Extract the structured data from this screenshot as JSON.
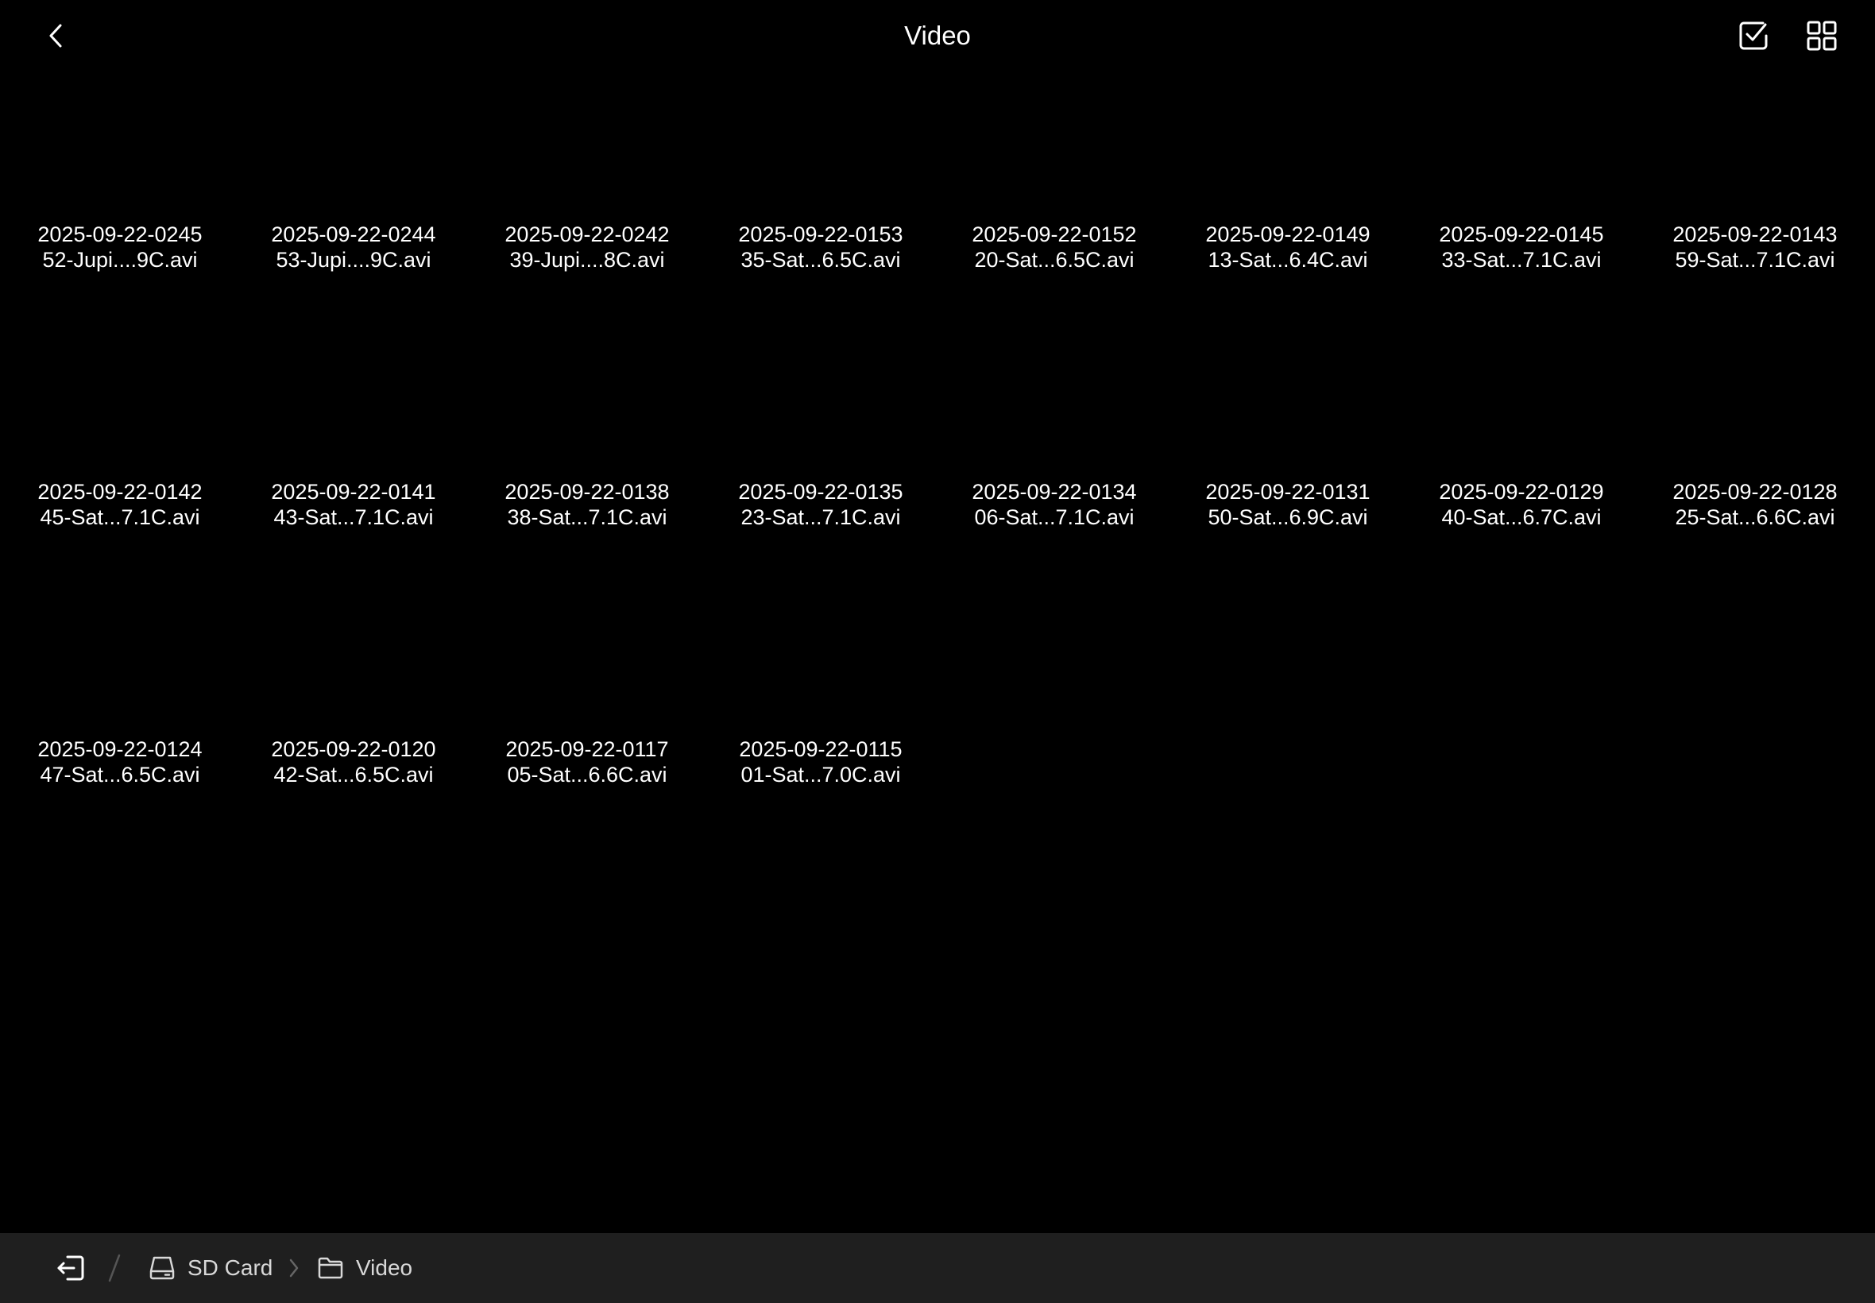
{
  "header": {
    "title": "Video",
    "back_icon": "chevron-left-icon",
    "select_icon": "checkbox-checked-icon",
    "view_icon": "grid-view-icon"
  },
  "files": [
    {
      "line1": "2025-09-22-0245",
      "line2": "52-Jupi....9C.avi"
    },
    {
      "line1": "2025-09-22-0244",
      "line2": "53-Jupi....9C.avi"
    },
    {
      "line1": "2025-09-22-0242",
      "line2": "39-Jupi....8C.avi"
    },
    {
      "line1": "2025-09-22-0153",
      "line2": "35-Sat...6.5C.avi"
    },
    {
      "line1": "2025-09-22-0152",
      "line2": "20-Sat...6.5C.avi"
    },
    {
      "line1": "2025-09-22-0149",
      "line2": "13-Sat...6.4C.avi"
    },
    {
      "line1": "2025-09-22-0145",
      "line2": "33-Sat...7.1C.avi"
    },
    {
      "line1": "2025-09-22-0143",
      "line2": "59-Sat...7.1C.avi"
    },
    {
      "line1": "2025-09-22-0142",
      "line2": "45-Sat...7.1C.avi"
    },
    {
      "line1": "2025-09-22-0141",
      "line2": "43-Sat...7.1C.avi"
    },
    {
      "line1": "2025-09-22-0138",
      "line2": "38-Sat...7.1C.avi"
    },
    {
      "line1": "2025-09-22-0135",
      "line2": "23-Sat...7.1C.avi"
    },
    {
      "line1": "2025-09-22-0134",
      "line2": "06-Sat...7.1C.avi"
    },
    {
      "line1": "2025-09-22-0131",
      "line2": "50-Sat...6.9C.avi"
    },
    {
      "line1": "2025-09-22-0129",
      "line2": "40-Sat...6.7C.avi"
    },
    {
      "line1": "2025-09-22-0128",
      "line2": "25-Sat...6.6C.avi"
    },
    {
      "line1": "2025-09-22-0124",
      "line2": "47-Sat...6.5C.avi"
    },
    {
      "line1": "2025-09-22-0120",
      "line2": "42-Sat...6.5C.avi"
    },
    {
      "line1": "2025-09-22-0117",
      "line2": "05-Sat...6.6C.avi"
    },
    {
      "line1": "2025-09-22-0115",
      "line2": "01-Sat...7.0C.avi"
    }
  ],
  "breadcrumb": {
    "exit_icon": "exit-icon",
    "items": [
      {
        "label": "SD Card",
        "icon": "drive-icon"
      },
      {
        "label": "Video",
        "icon": "folder-icon"
      }
    ]
  },
  "colors": {
    "background": "#000000",
    "bottom_bar": "#1f1f1f",
    "text": "#ffffff",
    "crumb_text": "#d8d8d8",
    "icon": "#ffffff"
  }
}
